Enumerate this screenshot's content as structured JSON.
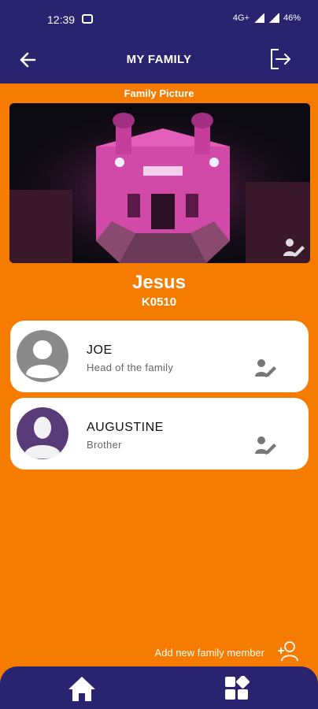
{
  "status_bar": {
    "time": "12:39",
    "network_label": "4G+",
    "battery": "46%"
  },
  "header": {
    "title": "MY FAMILY",
    "back_icon": "arrow-left-icon",
    "logout_icon": "logout-icon"
  },
  "family": {
    "picture_label": "Family Picture",
    "name": "Jesus",
    "code": "K0510"
  },
  "members": [
    {
      "name": "JOE",
      "role": "Head of the family",
      "avatar": "placeholder-person"
    },
    {
      "name": "AUGUSTINE",
      "role": "Brother",
      "avatar": "purple-bust"
    }
  ],
  "add_member": {
    "label": "Add new family member"
  },
  "bottom_nav": {
    "items": [
      "home-icon",
      "dashboard-icon"
    ]
  },
  "colors": {
    "primary": "#2a2370",
    "accent": "#f57c00",
    "card": "#ffffff"
  }
}
